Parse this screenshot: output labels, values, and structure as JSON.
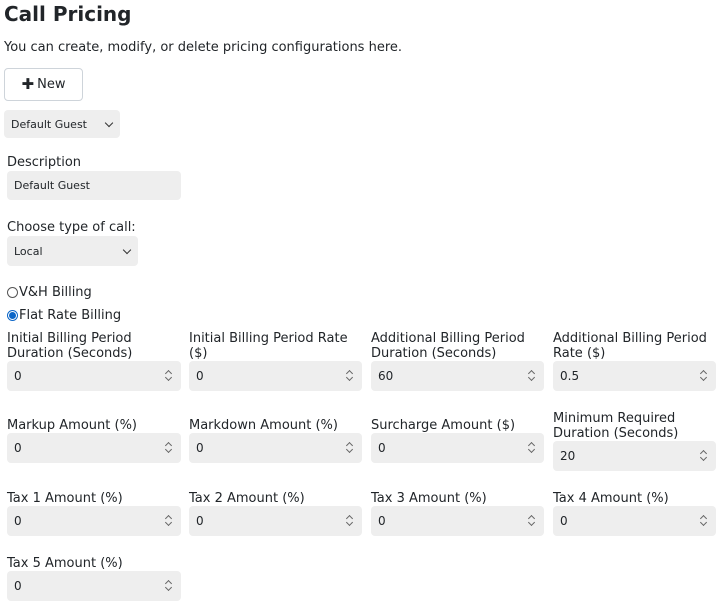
{
  "page": {
    "title": "Call Pricing",
    "intro": "You can create, modify, or delete pricing configurations here.",
    "new_label": "New"
  },
  "config_select": {
    "value": "Default Guest"
  },
  "description": {
    "label": "Description",
    "value": "Default Guest"
  },
  "call_type": {
    "label": "Choose type of call:",
    "value": "Local"
  },
  "billing": {
    "options": [
      {
        "label": "V&H Billing",
        "selected": false
      },
      {
        "label": "Flat Rate Billing",
        "selected": true
      }
    ]
  },
  "fields": {
    "initial_duration": {
      "label": "Initial Billing Period Duration (Seconds)",
      "value": "0"
    },
    "initial_rate": {
      "label": "Initial Billing Period Rate ($)",
      "value": "0"
    },
    "additional_duration": {
      "label": "Additional Billing Period Duration (Seconds)",
      "value": "60"
    },
    "additional_rate": {
      "label": "Additional Billing Period Rate ($)",
      "value": "0.5"
    },
    "markup": {
      "label": "Markup Amount (%)",
      "value": "0"
    },
    "markdown": {
      "label": "Markdown Amount (%)",
      "value": "0"
    },
    "surcharge": {
      "label": "Surcharge Amount ($)",
      "value": "0"
    },
    "min_duration": {
      "label": "Minimum Required Duration (Seconds)",
      "value": "20"
    },
    "tax1": {
      "label": "Tax 1 Amount (%)",
      "value": "0"
    },
    "tax2": {
      "label": "Tax 2 Amount (%)",
      "value": "0"
    },
    "tax3": {
      "label": "Tax 3 Amount (%)",
      "value": "0"
    },
    "tax4": {
      "label": "Tax 4 Amount (%)",
      "value": "0"
    },
    "tax5": {
      "label": "Tax 5 Amount (%)",
      "value": "0"
    }
  }
}
